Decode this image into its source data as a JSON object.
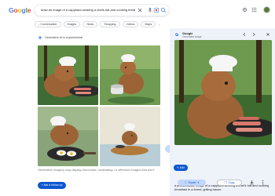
{
  "header": {
    "logo": [
      "G",
      "o",
      "o",
      "g",
      "l",
      "e"
    ],
    "logo_colors": [
      "#4285f4",
      "#ea4335",
      "#fbbc05",
      "#4285f4",
      "#34a853",
      "#ea4335"
    ],
    "search_query": "draw an image of a capybara wearing a chefs hat and cooking breakfast"
  },
  "chips": [
    "Conversation",
    "Images",
    "News",
    "Shopping",
    "Videos",
    "Maps"
  ],
  "left": {
    "gen_label": "Generative AI is experimental",
    "disclaimer": "Generative imagery may display inaccurate, misleading, or offensive images that don't",
    "followup": "Ask a follow up"
  },
  "right": {
    "title": "Google",
    "subtitle": "Generated image",
    "caption": "a photorealistic image of a capybara wearing a chef's hat and cooking breakfast in a forest, grilling bacon.",
    "edit": "Edit",
    "export": "Export",
    "copy": "Copy"
  },
  "colors": {
    "accent": "#0b57d0",
    "panel_bg": "#eef2f9",
    "capybara": "#9c6436",
    "chef_hat": "#f6f6f6",
    "forest": "#4d7a3c",
    "bacon": "#d9786c"
  }
}
